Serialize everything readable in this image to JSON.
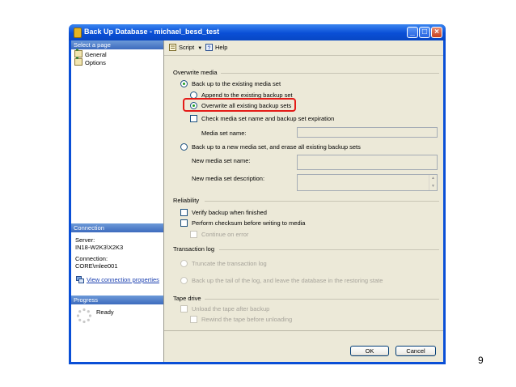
{
  "window": {
    "title": "Back Up Database - michael_besd_test"
  },
  "left_pane": {
    "select_page_header": "Select a page",
    "pages": [
      "General",
      "Options"
    ],
    "connection_header": "Connection",
    "server_label": "Server:",
    "server_value": "IN18-W2K3\\X2K3",
    "connection_label": "Connection:",
    "connection_value": "CORE\\mlee001",
    "view_connection_link": "View connection properties",
    "progress_header": "Progress",
    "progress_status": "Ready"
  },
  "toolbar": {
    "script_label": "Script",
    "help_label": "Help"
  },
  "overwrite_media": {
    "section_title": "Overwrite media",
    "backup_existing_set": "Back up to the existing media set",
    "append_to_existing": "Append to the existing backup set",
    "overwrite_all": "Overwrite all existing backup sets",
    "check_media_set": "Check media set name and backup set expiration",
    "media_set_name_label": "Media set name:",
    "media_set_name_value": "",
    "backup_new_set": "Back up to a new media set, and erase all existing backup sets",
    "new_media_set_name_label": "New media set name:",
    "new_media_set_name_value": "",
    "new_media_set_description_label": "New media set description:",
    "new_media_set_description_value": ""
  },
  "reliability": {
    "section_title": "Reliability",
    "verify_backup": "Verify backup when finished",
    "perform_checksum": "Perform checksum before writing to media",
    "continue_on_error": "Continue on error"
  },
  "transaction_log": {
    "section_title": "Transaction log",
    "truncate": "Truncate the transaction log",
    "backup_tail": "Back up the tail of the log, and leave the database in the restoring state"
  },
  "tape_drive": {
    "section_title": "Tape drive",
    "unload_tape": "Unload the tape after backup",
    "rewind_tape": "Rewind the tape before unloading"
  },
  "buttons": {
    "ok": "OK",
    "cancel": "Cancel"
  },
  "slide_number": "9",
  "colors": {
    "title_bar": "#0a4fd6",
    "pane_header": "#3d6bbd",
    "highlight": "#e41b17",
    "dialog_bg": "#ece9d8"
  }
}
